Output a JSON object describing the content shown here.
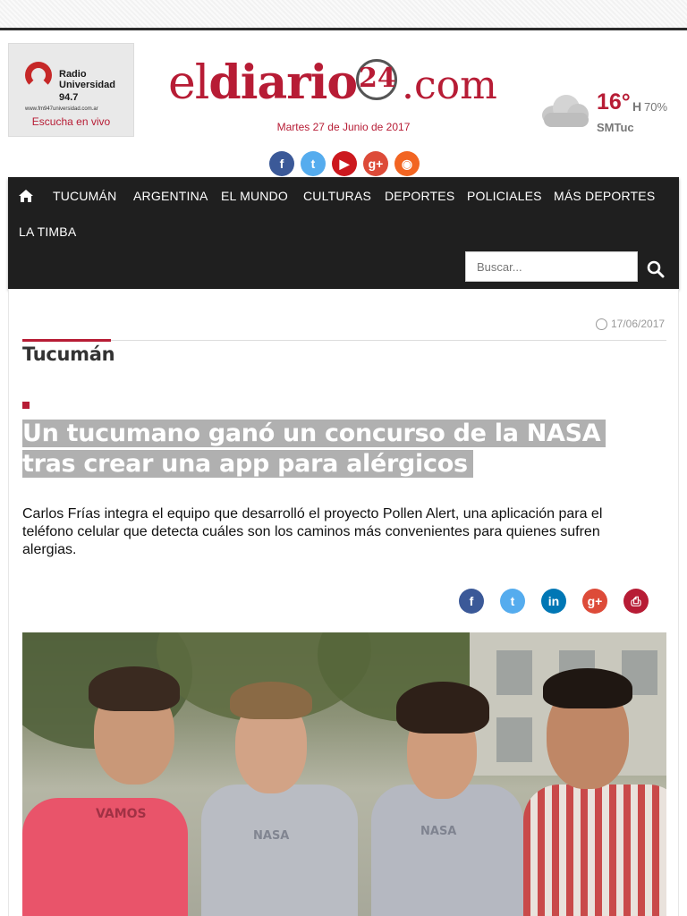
{
  "radio": {
    "name_line1": "Radio",
    "name_line2": "Universidad",
    "frequency": "94.7",
    "url": "www.fm947universidad.com.ar",
    "listen_label": "Escucha en vivo"
  },
  "logo": {
    "part1": "el",
    "part2": "diario",
    "number": "24",
    "part3": ".com"
  },
  "date": "Martes 27 de Junio de 2017",
  "weather": {
    "temperature": "16°",
    "humidity_label": "H",
    "humidity": "70%",
    "station": "SMTuc",
    "icon": "cloud-icon"
  },
  "social_header": [
    {
      "icon": "facebook-icon",
      "glyph": "f",
      "color": "#3b5998"
    },
    {
      "icon": "twitter-icon",
      "glyph": "t",
      "color": "#55acee"
    },
    {
      "icon": "youtube-icon",
      "glyph": "▶",
      "color": "#cc181e"
    },
    {
      "icon": "google-plus-icon",
      "glyph": "g+",
      "color": "#dd4b39"
    },
    {
      "icon": "rss-icon",
      "glyph": "◉",
      "color": "#f26522"
    }
  ],
  "nav": {
    "home_icon": "home-icon",
    "items": [
      "TUCUMÁN",
      "ARGENTINA",
      "EL MUNDO",
      "CULTURAS",
      "DEPORTES",
      "POLICIALES",
      "MÁS DEPORTES",
      "LA TIMBA"
    ],
    "search_placeholder": "Buscar...",
    "search_icon": "search-icon"
  },
  "article": {
    "date": "17/06/2017",
    "section": "Tucumán",
    "headline": "Un tucumano ganó un concurso de la NASA tras crear una app para alérgicos",
    "summary": "Carlos Frías integra el equipo que desarrolló el proyecto Pollen Alert, una aplicación para el teléfono celular que detecta cuáles son los caminos más convenientes para quienes sufren alergias."
  },
  "share_buttons": [
    {
      "icon": "facebook-icon",
      "glyph": "f",
      "color": "#3b5998"
    },
    {
      "icon": "twitter-icon",
      "glyph": "t",
      "color": "#55acee"
    },
    {
      "icon": "linkedin-icon",
      "glyph": "in",
      "color": "#0077b5"
    },
    {
      "icon": "google-plus-icon",
      "glyph": "g+",
      "color": "#dd4b39"
    },
    {
      "icon": "print-icon",
      "glyph": "⎙",
      "color": "#b71c35"
    }
  ],
  "colors": {
    "brand": "#b71c35",
    "nav_bg": "#1f1f1f"
  }
}
